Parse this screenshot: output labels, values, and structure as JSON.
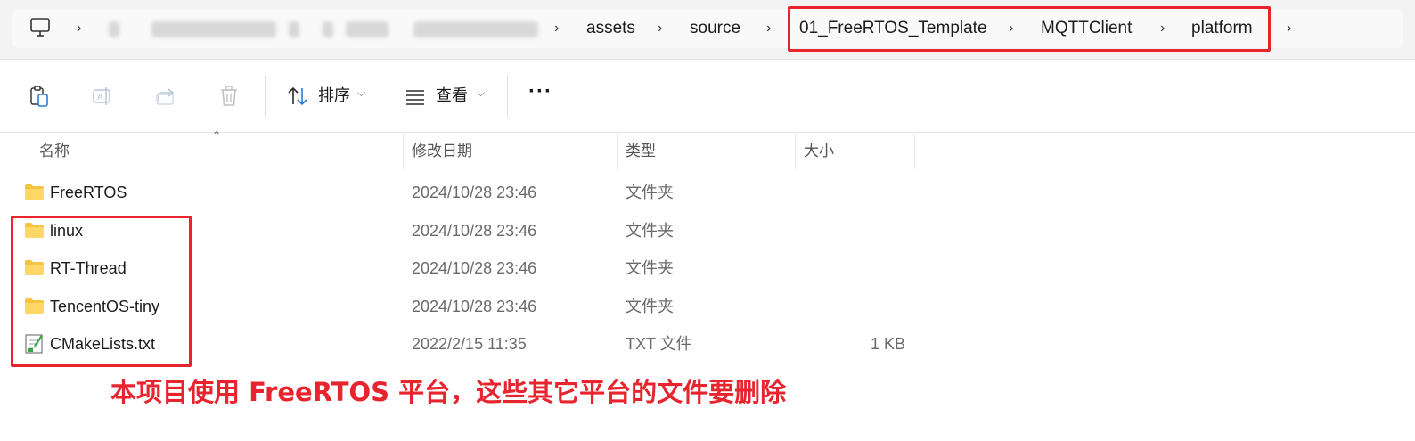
{
  "address_bar": {
    "icons": [
      "computer-icon",
      "chevron-right-icon"
    ],
    "crumbs": [
      "assets",
      "source",
      "01_FreeRTOS_Template",
      "MQTTClient",
      "platform"
    ]
  },
  "toolbar": {
    "icons": [
      "clipboard-icon",
      "rename-icon",
      "share-icon",
      "trash-icon",
      "sort-icon",
      "view-icon",
      "more-icon"
    ],
    "sort_label": "排序",
    "view_label": "查看",
    "more_label": "···"
  },
  "columns": {
    "name": "名称",
    "modified": "修改日期",
    "type": "类型",
    "size": "大小"
  },
  "files": [
    {
      "name": "FreeRTOS",
      "modified": "2024/10/28 23:46",
      "type": "文件夹",
      "size": "",
      "icon": "folder-icon"
    },
    {
      "name": "linux",
      "modified": "2024/10/28 23:46",
      "type": "文件夹",
      "size": "",
      "icon": "folder-icon"
    },
    {
      "name": "RT-Thread",
      "modified": "2024/10/28 23:46",
      "type": "文件夹",
      "size": "",
      "icon": "folder-icon"
    },
    {
      "name": "TencentOS-tiny",
      "modified": "2024/10/28 23:46",
      "type": "文件夹",
      "size": "",
      "icon": "folder-icon"
    },
    {
      "name": "CMakeLists.txt",
      "modified": "2022/2/15 11:35",
      "type": "TXT 文件",
      "size": "1 KB",
      "icon": "text-file-icon"
    }
  ],
  "annotation": "本项目使用 FreeRTOS 平台，这些其它平台的文件要删除",
  "colors": {
    "highlight": "#e8252e",
    "folder": "#f5c542"
  }
}
